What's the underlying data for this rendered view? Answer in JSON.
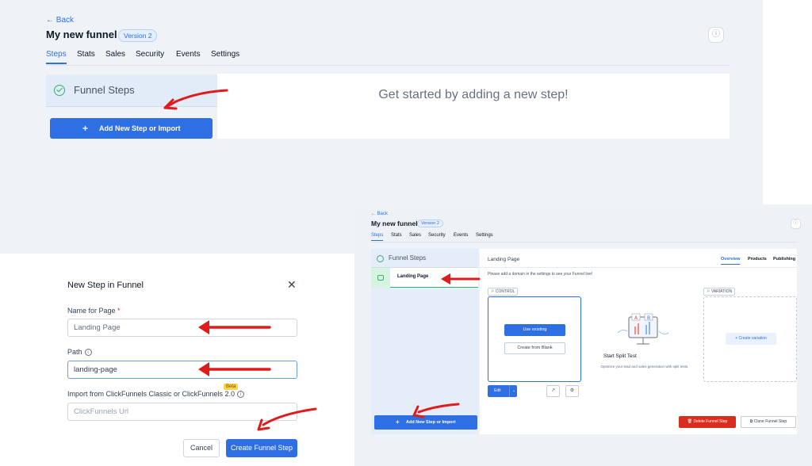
{
  "panel1": {
    "back": "← Back",
    "title": "My new funnel",
    "version": "Version 2",
    "info_icon": "info-icon",
    "tabs": [
      "Steps",
      "Stats",
      "Sales",
      "Security",
      "Events",
      "Settings"
    ],
    "active_tab": "Steps",
    "sidebar_title": "Funnel Steps",
    "add_button": "Add New Step or Import",
    "empty_message": "Get started by adding a new step!"
  },
  "modal": {
    "title": "New Step in Funnel",
    "close": "✕",
    "name_label": "Name for Page",
    "required_mark": "*",
    "name_value": "Landing Page",
    "path_label": "Path",
    "path_value": "landing-page",
    "beta": "Beta",
    "import_label": "Import from ClickFunnels Classic or ClickFunnels 2.0",
    "import_placeholder": "ClickFunnels Url",
    "cancel": "Cancel",
    "create": "Create Funnel Step"
  },
  "panel3": {
    "back": "← Back",
    "title": "My new funnel",
    "version": "Version 2",
    "tabs": [
      "Steps",
      "Stats",
      "Sales",
      "Security",
      "Events",
      "Settings"
    ],
    "sidebar_title": "Funnel Steps",
    "step_label": "Landing Page",
    "add_button": "Add New Step or Import",
    "page_title": "Landing Page",
    "page_tabs": [
      "Overview",
      "Products",
      "Publishing"
    ],
    "notice": "Please add a domain in the settings to see your Funnel live!",
    "control_tag": "⚐ CONTROL",
    "variation_tag": "⚐ VARIATION",
    "use_existing": "Use existing",
    "create_blank": "Create from Blank",
    "edit": "Edit",
    "split_title": "Start Split Test",
    "split_desc": "Optimize your lead and sales generation with split tests.",
    "create_variation": "Create variation",
    "delete": "Delete Funnel Step",
    "clone": "Clone Funnel Step"
  },
  "colors": {
    "primary": "#2f6fe4",
    "success": "#35b06a",
    "danger": "#d92d20",
    "annotation_arrow": "#e01b1b"
  }
}
